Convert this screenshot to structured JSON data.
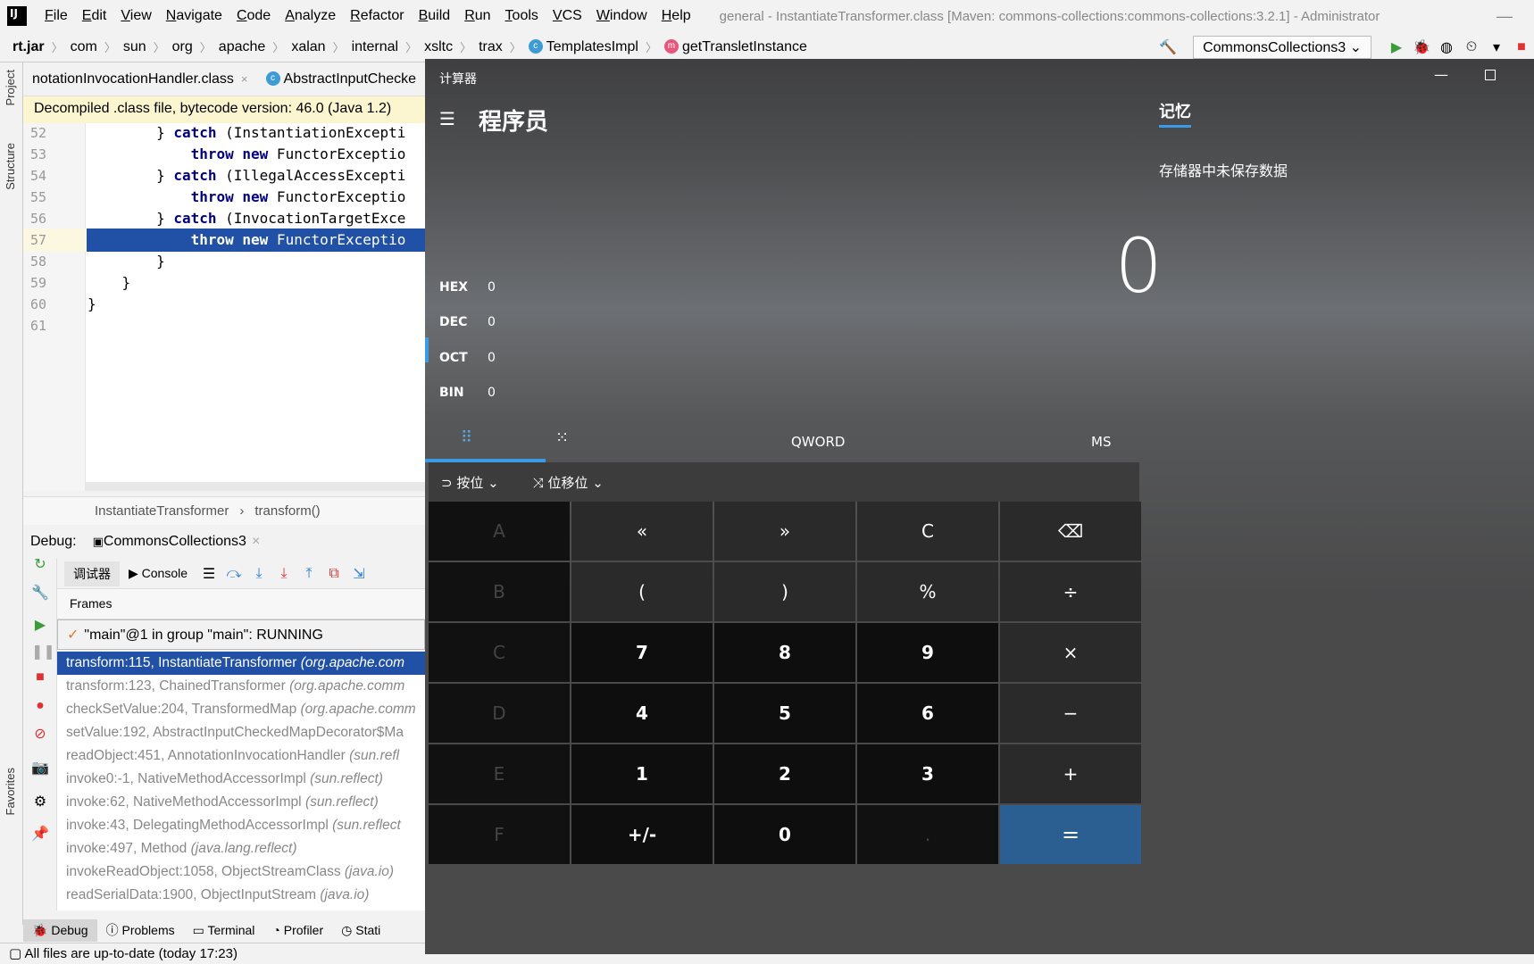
{
  "menubar": {
    "items": [
      "File",
      "Edit",
      "View",
      "Navigate",
      "Code",
      "Analyze",
      "Refactor",
      "Build",
      "Run",
      "Tools",
      "VCS",
      "Window",
      "Help"
    ],
    "window_title": "general - InstantiateTransformer.class [Maven: commons-collections:commons-collections:3.2.1] - Administrator",
    "minimize": "—"
  },
  "navbar": {
    "crumbs": [
      "rt.jar",
      "com",
      "sun",
      "org",
      "apache",
      "xalan",
      "internal",
      "xsltc",
      "trax"
    ],
    "class_crumb": "TemplatesImpl",
    "method_crumb": "getTransletInstance",
    "run_config": "CommonsCollections3",
    "icons": {
      "build": "🔨",
      "run": "▶",
      "debug": "🐞",
      "coverage": "◍",
      "profile": "⏲",
      "more": "▾",
      "stop": "■"
    }
  },
  "left_strip": {
    "project": "Project",
    "structure": "Structure",
    "favorites": "Favorites"
  },
  "editor_tabs": [
    {
      "label": "notationInvocationHandler.class",
      "close": "×"
    },
    {
      "label": "AbstractInputChecke",
      "close": ""
    }
  ],
  "banner": "Decompiled .class file, bytecode version: 46.0 (Java 1.2)",
  "code_lines": [
    {
      "num": "52",
      "pre": "        } ",
      "kw": "catch",
      "post": " (InstantiationExcepti"
    },
    {
      "num": "53",
      "pre": "            ",
      "kw": "throw new",
      "post": " FunctorExceptio"
    },
    {
      "num": "54",
      "pre": "        } ",
      "kw": "catch",
      "post": " (IllegalAccessExcepti"
    },
    {
      "num": "55",
      "pre": "            ",
      "kw": "throw new",
      "post": " FunctorExceptio"
    },
    {
      "num": "56",
      "pre": "        } ",
      "kw": "catch",
      "post": " (InvocationTargetExce"
    },
    {
      "num": "57",
      "pre": "            ",
      "kw": "throw new",
      "post": " FunctorExceptio"
    },
    {
      "num": "58",
      "pre": "        }",
      "kw": "",
      "post": ""
    },
    {
      "num": "59",
      "pre": "    }",
      "kw": "",
      "post": ""
    },
    {
      "num": "60",
      "pre": "}",
      "kw": "",
      "post": ""
    },
    {
      "num": "61",
      "pre": "",
      "kw": "",
      "post": ""
    }
  ],
  "footer_crumbs": {
    "class": "InstantiateTransformer",
    "sep": "›",
    "method": "transform()"
  },
  "debug": {
    "label": "Debug:",
    "session": "CommonsCollections3",
    "close": "×",
    "debugger_tab": "调试器",
    "console_tab": "Console",
    "frames_header": "Frames",
    "thread": "\"main\"@1 in group \"main\": RUNNING",
    "check": "✓",
    "frames": [
      {
        "loc": "transform:115, InstantiateTransformer ",
        "pkg": "(org.apache.com"
      },
      {
        "loc": "transform:123, ChainedTransformer ",
        "pkg": "(org.apache.comm"
      },
      {
        "loc": "checkSetValue:204, TransformedMap ",
        "pkg": "(org.apache.comm"
      },
      {
        "loc": "setValue:192, AbstractInputCheckedMapDecorator$Ma",
        "pkg": ""
      },
      {
        "loc": "readObject:451, AnnotationInvocationHandler ",
        "pkg": "(sun.refl"
      },
      {
        "loc": "invoke0:-1, NativeMethodAccessorImpl ",
        "pkg": "(sun.reflect)"
      },
      {
        "loc": "invoke:62, NativeMethodAccessorImpl ",
        "pkg": "(sun.reflect)"
      },
      {
        "loc": "invoke:43, DelegatingMethodAccessorImpl ",
        "pkg": "(sun.reflect"
      },
      {
        "loc": "invoke:497, Method ",
        "pkg": "(java.lang.reflect)"
      },
      {
        "loc": "invokeReadObject:1058, ObjectStreamClass ",
        "pkg": "(java.io)"
      },
      {
        "loc": "readSerialData:1900, ObjectInputStream ",
        "pkg": "(java.io)"
      }
    ]
  },
  "bottom_tabs": [
    "Debug",
    "Problems",
    "Terminal",
    "Profiler",
    "Stati"
  ],
  "status": "All files are up-to-date (today 17:23)",
  "calc": {
    "title": "计算器",
    "mode": "程序员",
    "display": "0",
    "radix": [
      {
        "name": "HEX",
        "value": "0"
      },
      {
        "name": "DEC",
        "value": "0"
      },
      {
        "name": "OCT",
        "value": "0"
      },
      {
        "name": "BIN",
        "value": "0"
      }
    ],
    "word_size": "QWORD",
    "ms": "MS",
    "bitwise": "按位",
    "shift": "位移位",
    "memory_title": "记忆",
    "memory_empty": "存储器中未保存数据",
    "window_min": "—",
    "menu_icon": "☰",
    "keypad_icon": "⠿",
    "bit_icon": "⁙",
    "keys": [
      {
        "label": "A",
        "kind": "dis"
      },
      {
        "label": "«",
        "kind": "fn"
      },
      {
        "label": "»",
        "kind": "fn"
      },
      {
        "label": "C",
        "kind": "fn"
      },
      {
        "label": "⌫",
        "kind": "fn"
      },
      {
        "label": "B",
        "kind": "dis"
      },
      {
        "label": "(",
        "kind": "fn"
      },
      {
        "label": ")",
        "kind": "fn"
      },
      {
        "label": "%",
        "kind": "fn"
      },
      {
        "label": "÷",
        "kind": "fn"
      },
      {
        "label": "C",
        "kind": "dis"
      },
      {
        "label": "7",
        "kind": "num"
      },
      {
        "label": "8",
        "kind": "num"
      },
      {
        "label": "9",
        "kind": "num"
      },
      {
        "label": "×",
        "kind": "fn"
      },
      {
        "label": "D",
        "kind": "dis"
      },
      {
        "label": "4",
        "kind": "num"
      },
      {
        "label": "5",
        "kind": "num"
      },
      {
        "label": "6",
        "kind": "num"
      },
      {
        "label": "−",
        "kind": "fn"
      },
      {
        "label": "E",
        "kind": "dis"
      },
      {
        "label": "1",
        "kind": "num"
      },
      {
        "label": "2",
        "kind": "num"
      },
      {
        "label": "3",
        "kind": "num"
      },
      {
        "label": "+",
        "kind": "fn"
      },
      {
        "label": "F",
        "kind": "dis"
      },
      {
        "label": "+/-",
        "kind": "num"
      },
      {
        "label": "0",
        "kind": "num"
      },
      {
        "label": ".",
        "kind": "dis"
      },
      {
        "label": "=",
        "kind": "eq"
      }
    ]
  }
}
